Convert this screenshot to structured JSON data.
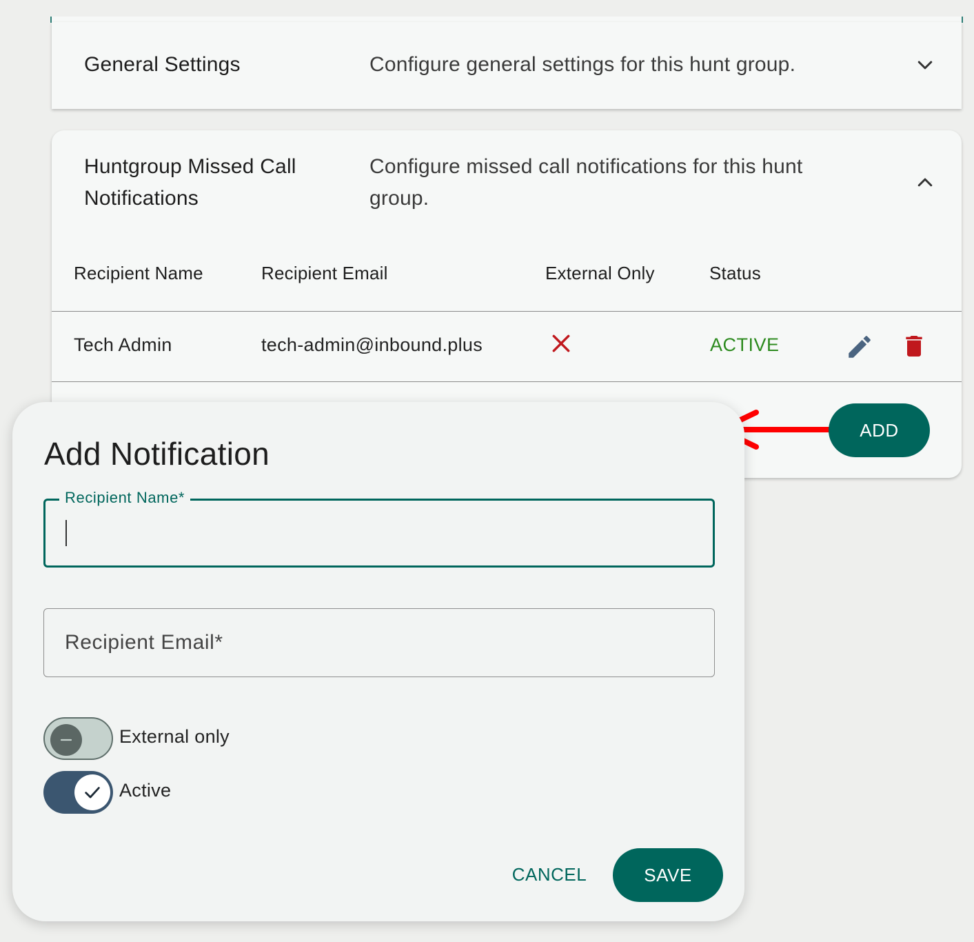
{
  "general": {
    "title": "General Settings",
    "description": "Configure general settings for this hunt group.",
    "expand_icon": "chevron-down-icon"
  },
  "missed_call": {
    "title_line1": "Huntgroup Missed Call",
    "title_line2": "Notifications",
    "description_line1": "Configure missed call notifications for this hunt",
    "description_line2": "group.",
    "collapse_icon": "chevron-up-icon",
    "columns": [
      "Recipient Name",
      "Recipient Email",
      "External Only",
      "Status"
    ],
    "rows": [
      {
        "name": "Tech Admin",
        "email": "tech-admin@inbound.plus",
        "external_only_icon": "close-icon",
        "status": "ACTIVE"
      }
    ],
    "add_label": "ADD"
  },
  "dialog": {
    "title": "Add Notification",
    "recipient_name_label": "Recipient Name*",
    "recipient_name_value": "",
    "recipient_email_placeholder": "Recipient Email*",
    "external_only_label": "External only",
    "external_only_checked": false,
    "active_label": "Active",
    "active_checked": true,
    "cancel_label": "CANCEL",
    "save_label": "SAVE"
  },
  "colors": {
    "primary": "#00665c",
    "status_active": "#2c8a1e",
    "danger": "#c0181d",
    "edit": "#4a6480",
    "annotation_arrow": "#ff0000"
  }
}
